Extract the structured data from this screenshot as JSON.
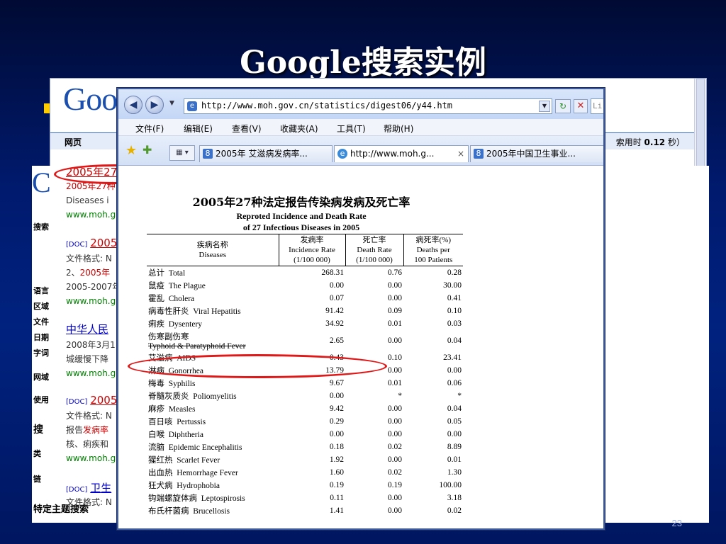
{
  "slide": {
    "title": "Google搜索实例",
    "page_number": "23"
  },
  "google_page": {
    "logo": "Goo",
    "logo_partial": "C",
    "web_tab": "网页",
    "time_label": "索用时",
    "time_value": "0.12",
    "time_unit": "秒）",
    "sidebar": [
      "搜索",
      "语言",
      "区域",
      "文件",
      "日期",
      "字词",
      "网域",
      "使用",
      "搜",
      "类",
      "链"
    ],
    "footer_text": "特定主题搜索",
    "results": [
      {
        "type": "link",
        "text": "2005年27",
        "color": "red"
      },
      {
        "type": "text",
        "text": "2005年27种",
        "color": "red"
      },
      {
        "type": "text",
        "text": "Diseases i"
      },
      {
        "type": "url",
        "text": "www.moh.g"
      },
      {
        "type": "doclink",
        "tag": "[DOC]",
        "text": "2005"
      },
      {
        "type": "text",
        "text": "文件格式: N"
      },
      {
        "type": "mixed",
        "prefix": "2、",
        "text": "2005年"
      },
      {
        "type": "text",
        "text": "2005-2007年"
      },
      {
        "type": "url",
        "text": "www.moh.g"
      },
      {
        "type": "link",
        "text": "中华人民"
      },
      {
        "type": "text",
        "text": "2008年3月1"
      },
      {
        "type": "text",
        "text": "城缓慢下降"
      },
      {
        "type": "url",
        "text": "www.moh.g"
      },
      {
        "type": "doclink",
        "tag": "[DOC]",
        "text": "2005"
      },
      {
        "type": "text",
        "text": "文件格式: N"
      },
      {
        "type": "mixed2",
        "prefix": "报告",
        "text": "发病率"
      },
      {
        "type": "text",
        "text": "核、痢疾和"
      },
      {
        "type": "url",
        "text": "www.moh.g"
      },
      {
        "type": "doclink",
        "tag": "[DOC]",
        "text": "卫生"
      },
      {
        "type": "text",
        "text": "文件格式: N"
      }
    ]
  },
  "browser": {
    "address": "http://www.moh.gov.cn/statistics/digest06/y44.htm",
    "search_stub": "Li",
    "menu": [
      "文件(F)",
      "编辑(E)",
      "查看(V)",
      "收藏夹(A)",
      "工具(T)",
      "帮助(H)"
    ],
    "tabs": [
      {
        "label": "2005年 艾滋病发病率...",
        "icon": "8"
      },
      {
        "label": "http://www.moh.g...",
        "icon": "e",
        "close": "×"
      },
      {
        "label": "2005年中国卫生事业...",
        "icon": "8"
      }
    ]
  },
  "document": {
    "title": "2005年27种法定报告传染病发病及死亡率",
    "subtitle1": "Reproted Incidence and Death Rate",
    "subtitle2": "of 27 Infectious Diseases in 2005",
    "headers": {
      "disease_cn": "疾病名称",
      "disease_en": "Diseases",
      "inc_cn": "发病率",
      "inc_en": "Incidence Rate",
      "inc_unit": "(1/100 000)",
      "death_cn": "死亡率",
      "death_en": "Death Rate",
      "death_unit": "(1/100 000)",
      "fatal_cn": "病死率(%)",
      "fatal_en": "Deaths per",
      "fatal_unit": "100 Patients"
    },
    "rows": [
      {
        "cn": "总计",
        "en": "Total",
        "inc": "268.31",
        "death": "0.76",
        "fatal": "0.28"
      },
      {
        "cn": "鼠疫",
        "en": "The Plague",
        "inc": "0.00",
        "death": "0.00",
        "fatal": "30.00"
      },
      {
        "cn": "霍乱",
        "en": "Cholera",
        "inc": "0.07",
        "death": "0.00",
        "fatal": "0.41"
      },
      {
        "cn": "病毒性肝炎",
        "en": "Viral Hepatitis",
        "inc": "91.42",
        "death": "0.09",
        "fatal": "0.10"
      },
      {
        "cn": "痢疾",
        "en": "Dysentery",
        "inc": "34.92",
        "death": "0.01",
        "fatal": "0.03"
      },
      {
        "cn": "伤寒副伤寒",
        "en": "Typhoid & Paratyphoid Fever",
        "inc": "2.65",
        "death": "0.00",
        "fatal": "0.04"
      },
      {
        "cn": "艾滋病",
        "en": "AIDS",
        "inc": "0.43",
        "death": "0.10",
        "fatal": "23.41"
      },
      {
        "cn": "淋病",
        "en": "Gonorrhea",
        "inc": "13.79",
        "death": "0.00",
        "fatal": "0.00"
      },
      {
        "cn": "梅毒",
        "en": "Syphilis",
        "inc": "9.67",
        "death": "0.01",
        "fatal": "0.06"
      },
      {
        "cn": "脊髓灰质炎",
        "en": "Poliomyelitis",
        "inc": "0.00",
        "death": "*",
        "fatal": "*"
      },
      {
        "cn": "麻疹",
        "en": "Measles",
        "inc": "9.42",
        "death": "0.00",
        "fatal": "0.04"
      },
      {
        "cn": "百日咳",
        "en": "Pertussis",
        "inc": "0.29",
        "death": "0.00",
        "fatal": "0.05"
      },
      {
        "cn": "白喉",
        "en": "Diphtheria",
        "inc": "0.00",
        "death": "0.00",
        "fatal": "0.00"
      },
      {
        "cn": "流脑",
        "en": "Epidemic Encephalitis",
        "inc": "0.18",
        "death": "0.02",
        "fatal": "8.89"
      },
      {
        "cn": "猩红热",
        "en": "Scarlet Fever",
        "inc": "1.92",
        "death": "0.00",
        "fatal": "0.01"
      },
      {
        "cn": "出血热",
        "en": "Hemorrhage Fever",
        "inc": "1.60",
        "death": "0.02",
        "fatal": "1.30"
      },
      {
        "cn": "狂犬病",
        "en": "Hydrophobia",
        "inc": "0.19",
        "death": "0.19",
        "fatal": "100.00"
      },
      {
        "cn": "钩端螺旋体病",
        "en": "Leptospirosis",
        "inc": "0.11",
        "death": "0.00",
        "fatal": "3.18"
      },
      {
        "cn": "布氏杆菌病",
        "en": "Brucellosis",
        "inc": "1.41",
        "death": "0.00",
        "fatal": "0.02"
      }
    ]
  },
  "colors": {
    "annotation": "#e01818",
    "slide_title": "#ffffff",
    "bullet": "#ffcc00"
  }
}
